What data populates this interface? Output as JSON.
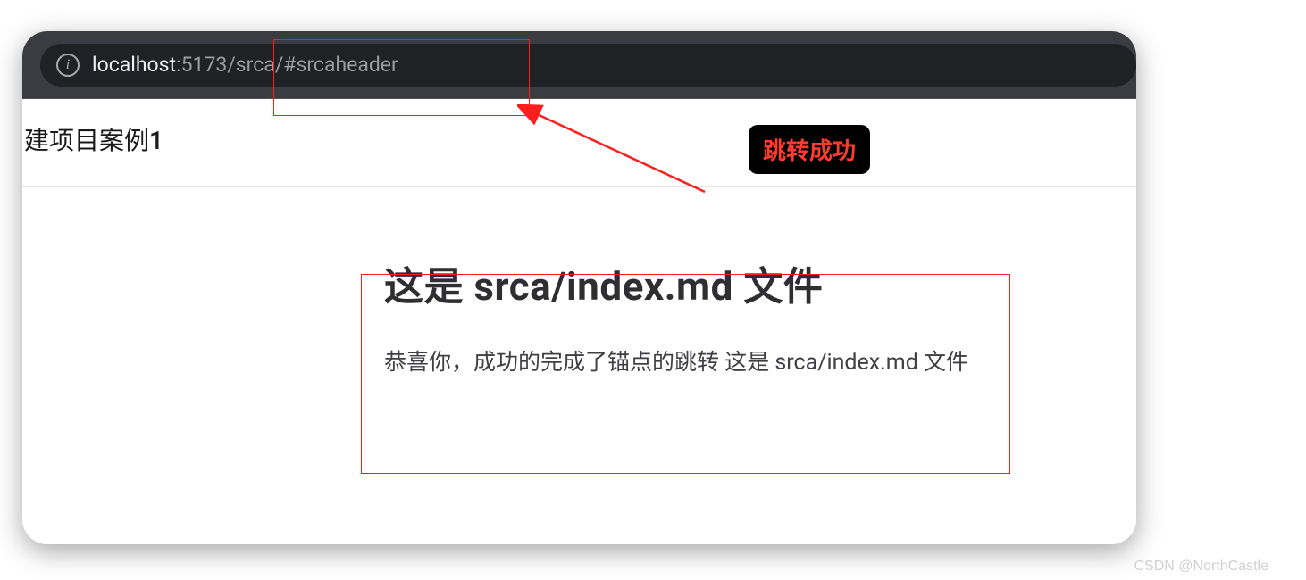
{
  "url": {
    "host": "localhost",
    "path": ":5173/srca/#srcaheader"
  },
  "project_label": "建项目案例1",
  "main": {
    "heading": "这是 srca/index.md 文件",
    "paragraph": "恭喜你，成功的完成了锚点的跳转 这是 srca/index.md 文件"
  },
  "annotation": {
    "badge": "跳转成功"
  },
  "watermark": "CSDN @NorthCastle",
  "icons": {
    "info": "i"
  }
}
